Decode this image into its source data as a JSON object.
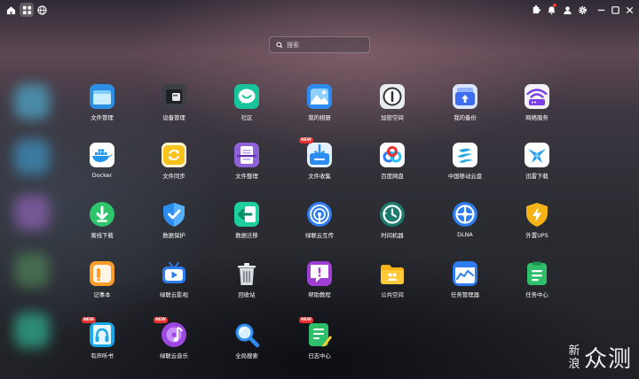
{
  "search": {
    "placeholder": "搜索"
  },
  "apps": [
    {
      "label": "文件管理",
      "icon": "folder-icon",
      "new": false
    },
    {
      "label": "设备管理",
      "icon": "device-icon",
      "new": false
    },
    {
      "label": "社区",
      "icon": "community-icon",
      "new": false
    },
    {
      "label": "我的相册",
      "icon": "photo-icon",
      "new": false
    },
    {
      "label": "加密空间",
      "icon": "encrypted-space-icon",
      "new": false
    },
    {
      "label": "我的备份",
      "icon": "backup-icon",
      "new": false
    },
    {
      "label": "网络服务",
      "icon": "wifi-icon",
      "new": false
    },
    {
      "label": "Docker",
      "icon": "docker-icon",
      "new": false
    },
    {
      "label": "文件同步",
      "icon": "sync-icon",
      "new": false
    },
    {
      "label": "文件整理",
      "icon": "scanner-icon",
      "new": false
    },
    {
      "label": "文件收集",
      "icon": "collect-icon",
      "new": true
    },
    {
      "label": "百度网盘",
      "icon": "baidu-cloud-icon",
      "new": false
    },
    {
      "label": "中国移动云盘",
      "icon": "china-mobile-cloud-icon",
      "new": false
    },
    {
      "label": "迅雷下载",
      "icon": "thunder-icon",
      "new": false
    },
    {
      "label": "离线下载",
      "icon": "download-icon",
      "new": false
    },
    {
      "label": "数据保护",
      "icon": "shield-icon",
      "new": false
    },
    {
      "label": "数据迁移",
      "icon": "migrate-icon",
      "new": false
    },
    {
      "label": "绿联云互传",
      "icon": "airdrop-icon",
      "new": false
    },
    {
      "label": "时间机器",
      "icon": "time-machine-icon",
      "new": false
    },
    {
      "label": "DLNA",
      "icon": "dlna-icon",
      "new": false
    },
    {
      "label": "外置UPS",
      "icon": "ups-icon",
      "new": false
    },
    {
      "label": "记事本",
      "icon": "notepad-icon",
      "new": false
    },
    {
      "label": "绿联云影视",
      "icon": "tv-icon",
      "new": false
    },
    {
      "label": "回收站",
      "icon": "trash-icon",
      "new": false
    },
    {
      "label": "帮助教程",
      "icon": "help-icon",
      "new": false
    },
    {
      "label": "公共空间",
      "icon": "public-space-icon",
      "new": false
    },
    {
      "label": "任务管理器",
      "icon": "task-manager-icon",
      "new": false
    },
    {
      "label": "任务中心",
      "icon": "task-center-icon",
      "new": false
    },
    {
      "label": "有声听书",
      "icon": "audiobook-icon",
      "new": true
    },
    {
      "label": "绿联云音乐",
      "icon": "music-icon",
      "new": true
    },
    {
      "label": "全局搜索",
      "icon": "global-search-icon",
      "new": false
    },
    {
      "label": "日志中心",
      "icon": "log-icon",
      "new": true
    }
  ],
  "badge_text": "NEW",
  "watermark": {
    "left": "新浪",
    "right": "众测"
  }
}
